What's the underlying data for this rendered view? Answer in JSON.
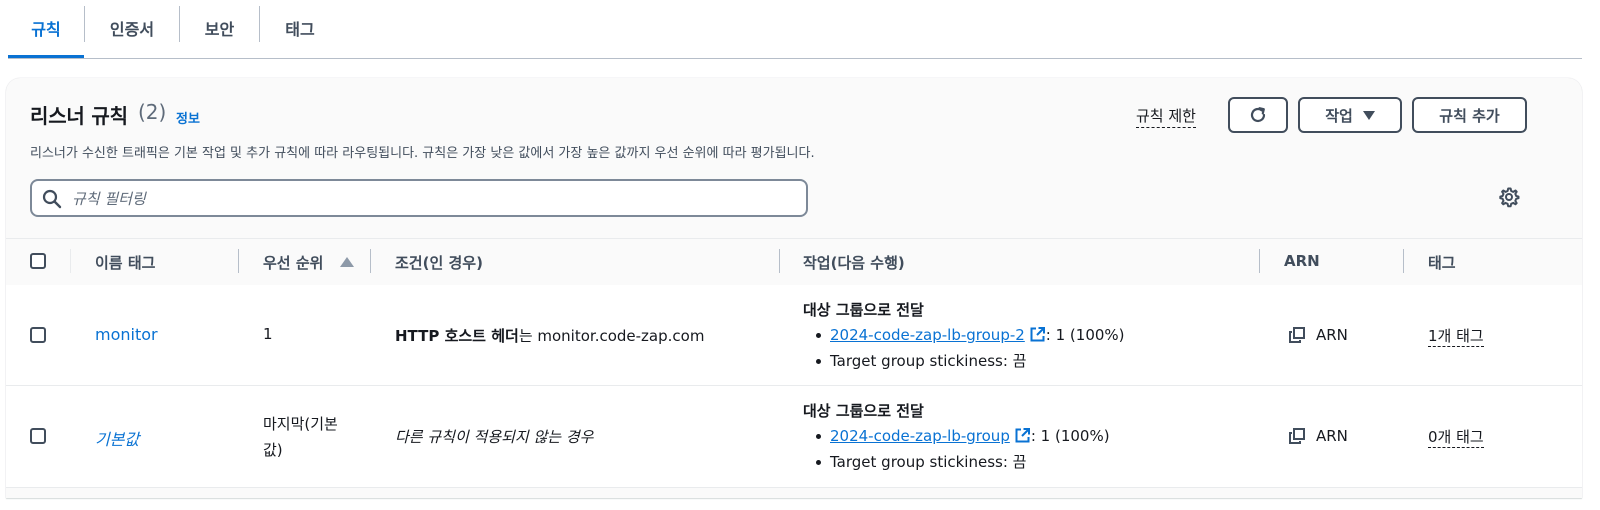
{
  "tabs": [
    {
      "label": "규칙",
      "active": true
    },
    {
      "label": "인증서",
      "active": false
    },
    {
      "label": "보안",
      "active": false
    },
    {
      "label": "태그",
      "active": false
    }
  ],
  "panel": {
    "title": "리스너 규칙",
    "count": "(2)",
    "info": "정보",
    "description": "리스너가 수신한 트래픽은 기본 작업 및 추가 규칙에 따라 라우팅됩니다. 규칙은 가장 낮은 값에서 가장 높은 값까지 우선 순위에 따라 평가됩니다.",
    "limit_label": "규칙 제한",
    "actions_label": "작업",
    "add_rule_label": "규칙 추가",
    "search_placeholder": "규칙 필터링"
  },
  "table": {
    "headers": {
      "name": "이름 태그",
      "priority": "우선 순위",
      "conditions": "조건(인 경우)",
      "actions": "작업(다음 수행)",
      "arn": "ARN",
      "tags": "태그"
    },
    "rows": [
      {
        "name": "monitor",
        "priority": "1",
        "condition_bold": "HTTP 호스트 헤더",
        "condition_suffix": "는 monitor.code-zap.com",
        "action_title": "대상 그룹으로 전달",
        "target_group": "2024-code-zap-lb-group-2",
        "weight": ": 1 (100%)",
        "stickiness": "Target group stickiness: 끔",
        "arn": "ARN",
        "tags": "1개 태그"
      },
      {
        "name": "기본값",
        "priority_line1": "마지막(기본",
        "priority_line2": "값)",
        "condition": "다른 규칙이 적용되지 않는 경우",
        "action_title": "대상 그룹으로 전달",
        "target_group": "2024-code-zap-lb-group",
        "weight": ": 1 (100%)",
        "stickiness": "Target group stickiness: 끔",
        "arn": "ARN",
        "tags": "0개 태그"
      }
    ]
  },
  "colors": {
    "accent": "#0972d3",
    "text": "#16191f",
    "muted": "#414d5c",
    "border": "#b6bec9"
  },
  "icons": [
    "search-icon",
    "refresh-icon",
    "caret-down-icon",
    "gear-icon",
    "external-link-icon",
    "copy-icon",
    "sort-ascending-icon"
  ]
}
